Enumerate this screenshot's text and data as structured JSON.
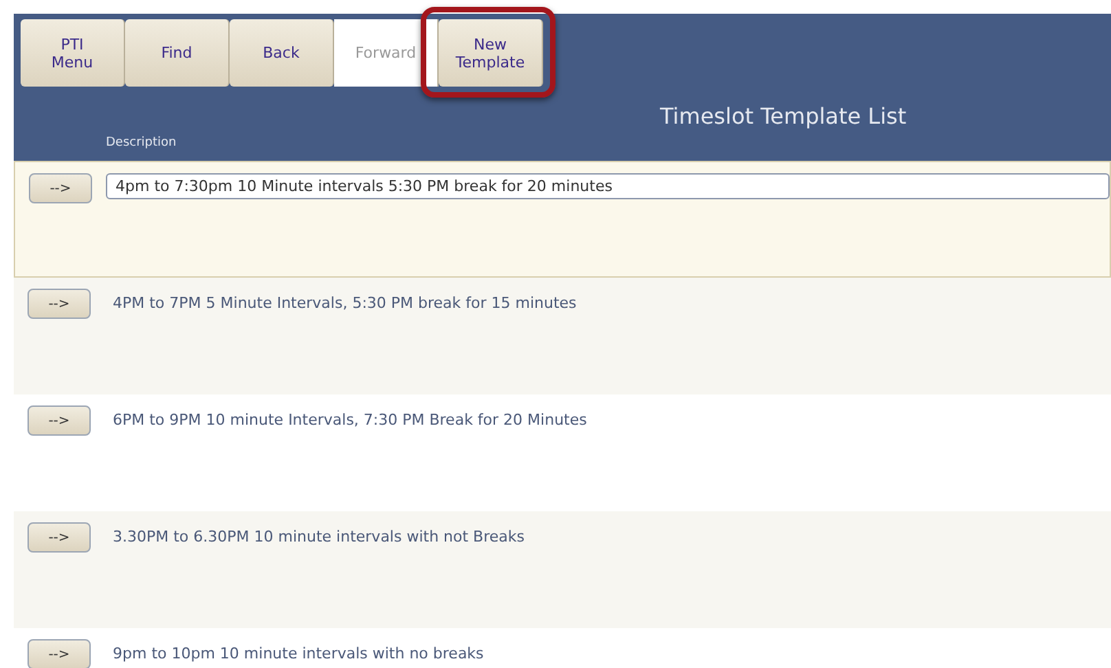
{
  "toolbar": [
    {
      "label": "PTI\nMenu",
      "disabled": false,
      "highlighted": false
    },
    {
      "label": "Find",
      "disabled": false,
      "highlighted": false
    },
    {
      "label": "Back",
      "disabled": false,
      "highlighted": false
    },
    {
      "label": "Forward",
      "disabled": true,
      "highlighted": false
    },
    {
      "label": "New\nTemplate",
      "disabled": false,
      "highlighted": true
    }
  ],
  "title": "Timeslot Template List",
  "columns": [
    "Description"
  ],
  "rows": [
    {
      "button": "-->",
      "description": "4pm to 7:30pm 10 Minute intervals 5:30 PM break for 20 minutes",
      "selected": true
    },
    {
      "button": "-->",
      "description": "4PM to 7PM 5 Minute Intervals, 5:30 PM break for 15 minutes",
      "selected": false
    },
    {
      "button": "-->",
      "description": "6PM to 9PM 10 minute Intervals, 7:30 PM Break for 20 Minutes",
      "selected": false
    },
    {
      "button": "-->",
      "description": "3.30PM to 6.30PM 10 minute intervals with not Breaks",
      "selected": false
    },
    {
      "button": "-->",
      "description": "9pm to 10pm 10 minute intervals with no breaks",
      "selected": false
    }
  ]
}
